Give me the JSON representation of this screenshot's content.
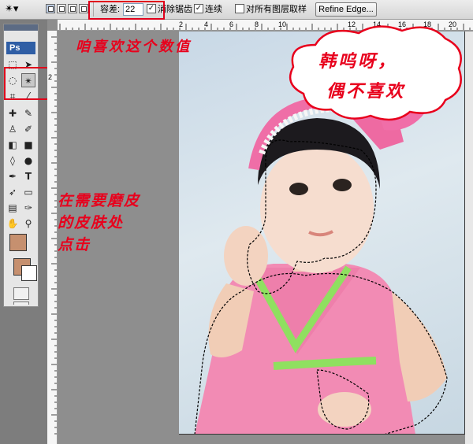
{
  "options_bar": {
    "tolerance_label": "容差:",
    "tolerance_value": "22",
    "anti_alias_label": "消除锯齿",
    "contiguous_label": "连续",
    "sample_all_layers_label": "对所有图层取样",
    "refine_edge_label": "Refine Edge..."
  },
  "toolbox": {
    "logo": "Ps"
  },
  "rulers": {
    "top_numbers": [
      "2",
      "4",
      "6",
      "8",
      "10",
      "12",
      "14",
      "16",
      "18",
      "20"
    ],
    "left_numbers": [
      "2"
    ]
  },
  "annotations": {
    "tolerance_note": "咱喜欢这个数值",
    "click_line_1": "在需要磨皮",
    "click_line_2": "的皮肤处",
    "click_line_3": "点击",
    "bubble_line_1": "韩呜呀，",
    "bubble_line_2": "偶不喜欢"
  },
  "colors": {
    "annotation_red": "#e8001c",
    "foreground_color": "#c6906f",
    "background_color": "#ffffff",
    "selection_marching_ants": "#000000"
  },
  "icons": [
    "magic-wand-icon",
    "marquee-icon",
    "move-icon",
    "lasso-icon",
    "crop-icon",
    "eyedropper-icon",
    "healing-brush-icon",
    "brush-icon",
    "clone-stamp-icon",
    "history-brush-icon",
    "eraser-icon",
    "gradient-icon",
    "blur-icon",
    "dodge-icon",
    "pen-icon",
    "type-icon",
    "path-selection-icon",
    "shape-icon",
    "notes-icon",
    "hand-icon",
    "zoom-icon"
  ]
}
